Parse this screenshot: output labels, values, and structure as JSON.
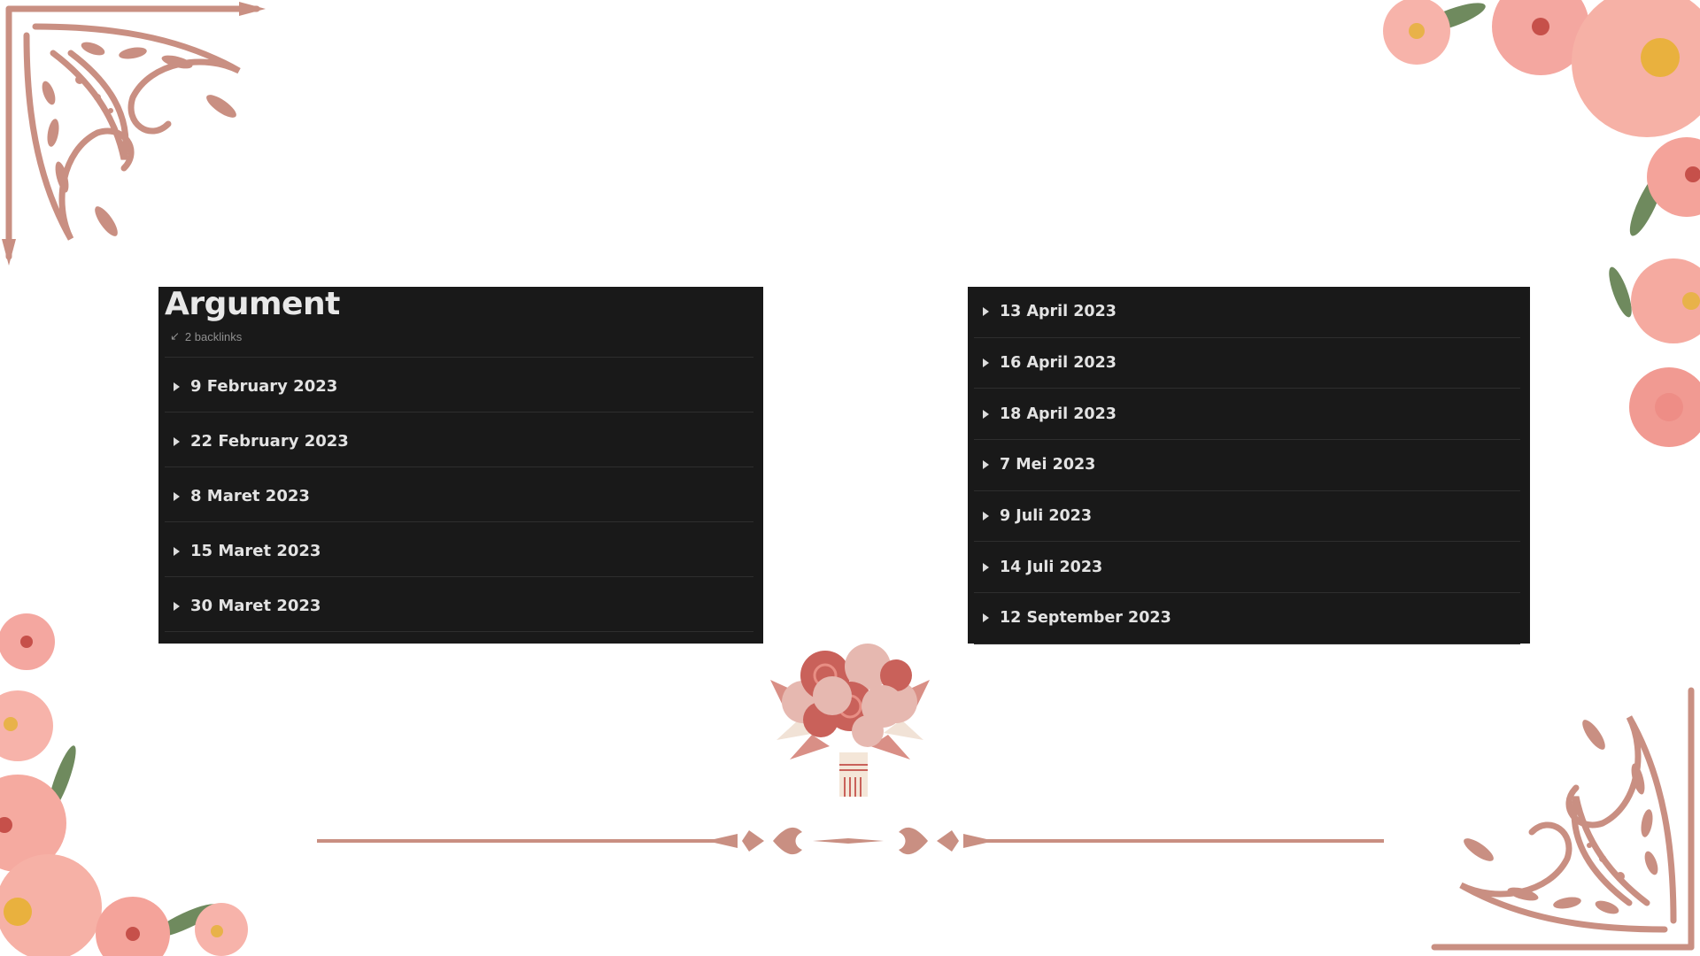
{
  "left_panel": {
    "title": "Argument",
    "backlinks_label": "2 backlinks",
    "items": [
      {
        "label": "9 February 2023"
      },
      {
        "label": "22 February 2023"
      },
      {
        "label": "8 Maret 2023"
      },
      {
        "label": "15 Maret 2023"
      },
      {
        "label": "30 Maret 2023"
      }
    ]
  },
  "right_panel": {
    "items": [
      {
        "label": "13 April 2023"
      },
      {
        "label": "16 April 2023"
      },
      {
        "label": "18 April 2023"
      },
      {
        "label": "7 Mei 2023"
      },
      {
        "label": "9 Juli 2023"
      },
      {
        "label": "14 Juli 2023"
      },
      {
        "label": "12 September 2023"
      }
    ]
  },
  "colors": {
    "panel_bg": "#191919",
    "accent_rose": "#c98f82",
    "flower_pink": "#f4a7a0",
    "rose_dark": "#c46a64"
  },
  "icons": {
    "toggle": "triangle-right-icon",
    "backlink": "arrow-down-left-icon"
  }
}
